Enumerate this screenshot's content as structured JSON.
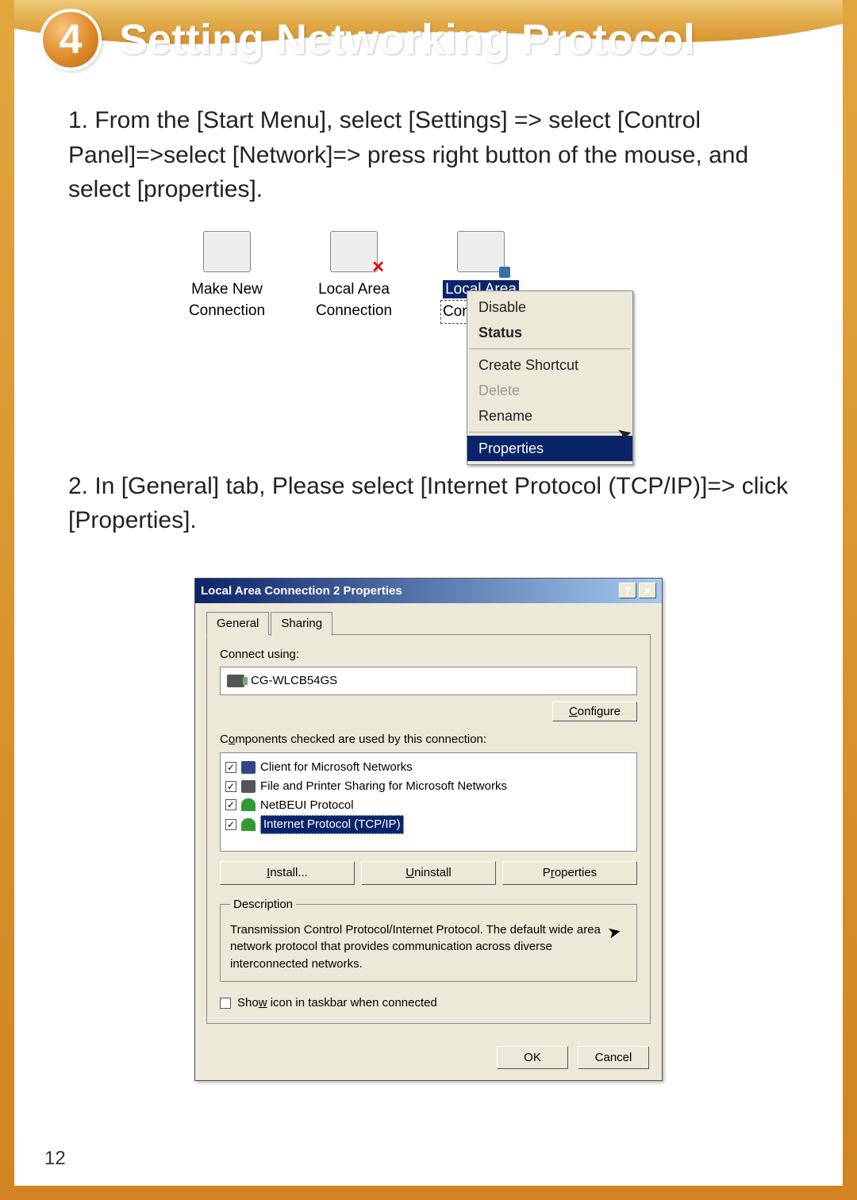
{
  "page": {
    "step_number": "4",
    "title": "Setting Networking Protocol",
    "page_number": "12"
  },
  "steps": {
    "s1": "1. From the [Start Menu], select [Settings] => select [Control Panel]=>select [Network]=> press right button of the mouse, and select [properties].",
    "s2": "2. In [General] tab, Please select [Internet Protocol (TCP/IP)]=> click [Properties]."
  },
  "icons": {
    "make_new": "Make New Connection",
    "lan1": "Local Area Connection",
    "lan2_line1": "Local Area",
    "lan2_line2": "Connection"
  },
  "context_menu": {
    "disable": "Disable",
    "status": "Status",
    "create_shortcut": "Create Shortcut",
    "delete": "Delete",
    "rename": "Rename",
    "properties": "Properties"
  },
  "dialog": {
    "title": "Local Area Connection 2 Properties",
    "tab_general": "General",
    "tab_sharing": "Sharing",
    "connect_using": "Connect using:",
    "nic": "CG-WLCB54GS",
    "configure": "Configure",
    "components_label": "Components checked are used by this connection:",
    "items": {
      "c1": "Client for Microsoft Networks",
      "c2": "File and Printer Sharing for Microsoft Networks",
      "c3": "NetBEUI Protocol",
      "c4": "Internet Protocol (TCP/IP)"
    },
    "install": "Install...",
    "uninstall": "Uninstall",
    "properties": "Properties",
    "desc_legend": "Description",
    "desc_text": "Transmission Control Protocol/Internet Protocol. The default wide area network protocol that provides communication across diverse interconnected networks.",
    "show_icon": "Show icon in taskbar when connected",
    "ok": "OK",
    "cancel": "Cancel",
    "help": "?",
    "close": "×"
  }
}
